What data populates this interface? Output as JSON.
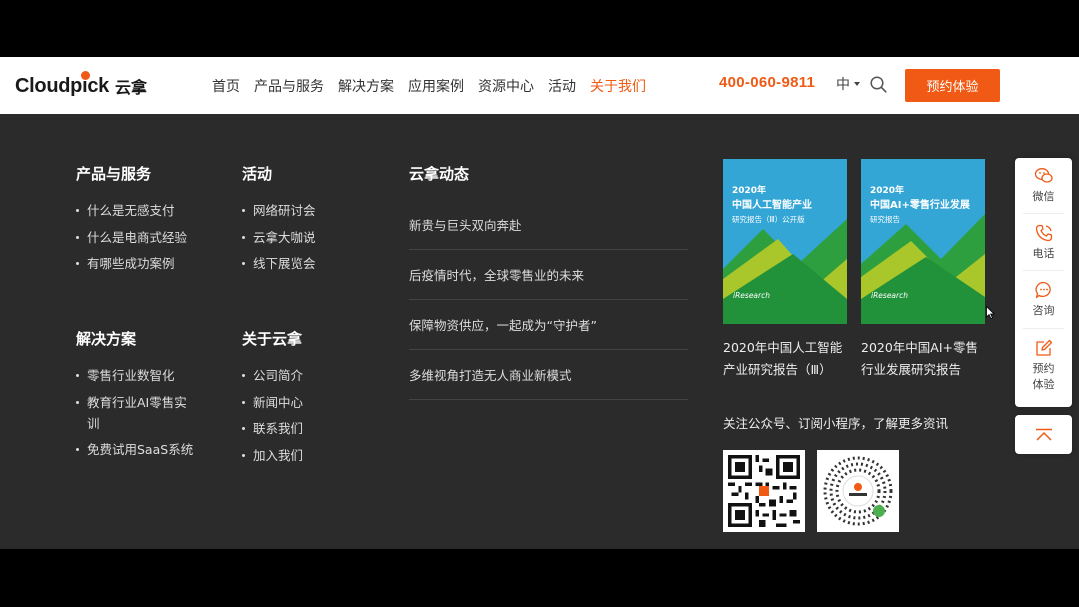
{
  "brand": {
    "name_en": "Cloudpick",
    "name_cn": "云拿"
  },
  "nav": {
    "items": [
      "首页",
      "产品与服务",
      "解决方案",
      "应用案例",
      "资源中心",
      "活动",
      "关于我们"
    ],
    "active_index": 6
  },
  "header": {
    "phone": "400-060-9811",
    "language": "中",
    "cta_label": "预约体验"
  },
  "columns": {
    "products": {
      "title": "产品与服务",
      "links": [
        "什么是无感支付",
        "什么是电商式经验",
        "有哪些成功案例"
      ]
    },
    "events": {
      "title": "活动",
      "links": [
        "网络研讨会",
        "云拿大咖说",
        "线下展览会"
      ]
    },
    "solutions": {
      "title": "解决方案",
      "links": [
        "零售行业数智化",
        "教育行业AI零售实训",
        "免费试用SaaS系统"
      ]
    },
    "about": {
      "title": "关于云拿",
      "links": [
        "公司简介",
        "新闻中心",
        "联系我们",
        "加入我们"
      ]
    }
  },
  "news": {
    "title": "云拿动态",
    "items": [
      "新贵与巨头双向奔赴",
      "后疫情时代，全球零售业的未来",
      "保障物资供应，一起成为“守护者”",
      "多维视角打造无人商业新模式"
    ]
  },
  "reports": [
    {
      "year": "2020年",
      "title": "中国人工智能产业",
      "subtitle": "研究报告（Ⅲ）公开版",
      "brand": "iResearch",
      "caption": "2020年中国人工智能产业研究报告（Ⅲ）"
    },
    {
      "year": "2020年",
      "title": "中国AI+零售行业发展",
      "subtitle": "研究报告",
      "brand": "iResearch",
      "caption": "2020年中国AI+零售行业发展研究报告"
    }
  ],
  "follow_text": "关注公众号、订阅小程序，了解更多资讯",
  "qr_codes": [
    "wechat-official-account-qr",
    "mini-program-qr"
  ],
  "toolbar": {
    "items": [
      {
        "label": "微信",
        "icon": "wechat-icon"
      },
      {
        "label": "电话",
        "icon": "phone-icon"
      },
      {
        "label": "咨询",
        "icon": "chat-icon"
      },
      {
        "label": "预约\n体验",
        "icon": "edit-icon"
      }
    ],
    "back_to_top_icon": "back-to-top-icon"
  },
  "colors": {
    "accent": "#f05a14",
    "panel_bg": "#2b2b2b",
    "header_bg": "#ffffff"
  }
}
